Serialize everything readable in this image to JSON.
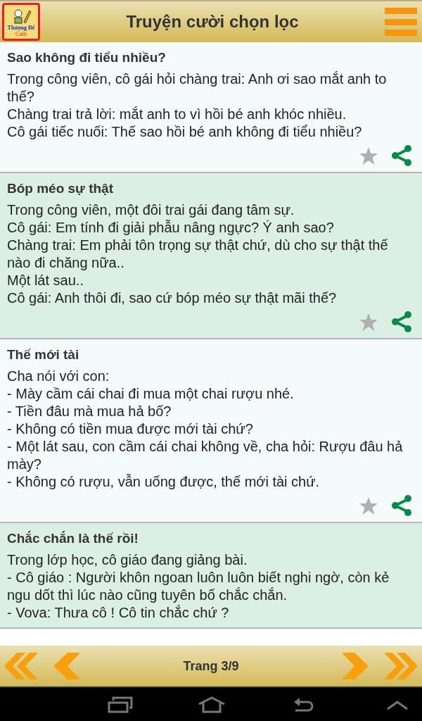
{
  "header": {
    "logo": [
      "Thượng Đế",
      "Cười"
    ],
    "title": "Truyện cười chọn lọc"
  },
  "jokes": [
    {
      "title": "Sao không đi tiểu nhiều?",
      "lines": [
        "Trong công viên, cô gái hỏi chàng trai: Anh ơi sao mắt anh to thế?",
        "Chàng trai trả lời: mắt anh to vì hồi bé anh khóc nhiều.",
        "Cô gái tiếc nuối: Thế sao hồi bé anh không đi tiểu nhiều?"
      ],
      "favorite": false
    },
    {
      "title": "Bóp méo sự thật",
      "lines": [
        "Trong công viên, một đôi trai gái đang tâm sự.",
        "Cô gái: Em tính đi giải phẫu nâng ngực? Ý anh sao?",
        "Chàng trai: Em phải tôn trọng sự thật chứ, dù cho sự thật thế nào đi chăng nữa..",
        "Một lát sau..",
        "Cô gái: Anh thôi đi, sao cứ bóp méo sự thật mãi thế?"
      ],
      "favorite": false
    },
    {
      "title": "Thế mới tài",
      "lines": [
        "Cha nói với con:",
        "- Mày cầm cái chai đi mua một chai rượu nhé.",
        "- Tiền đâu mà mua hả bố?",
        "- Không có tiền mua được mới tài chứ?",
        "- Một lát sau, con cầm cái chai không về, cha hỏi: Rượu đâu hả mày?",
        "- Không có rượu, vẫn uống được, thế mới tài chứ."
      ],
      "favorite": false
    },
    {
      "title": "Chắc chắn là thế rồi!",
      "lines": [
        "Trong lớp học, cô giáo đang giảng bài.",
        "- Cô giáo : Người khôn ngoan luôn luôn biết nghi ngờ, còn kẻ ngu dốt thì lúc nào cũng tuyên bố chắc chắn.",
        "- Vova: Thưa cô ! Cô tin chắc chứ ?"
      ]
    }
  ],
  "pager": {
    "label": "Trang 3/9"
  }
}
